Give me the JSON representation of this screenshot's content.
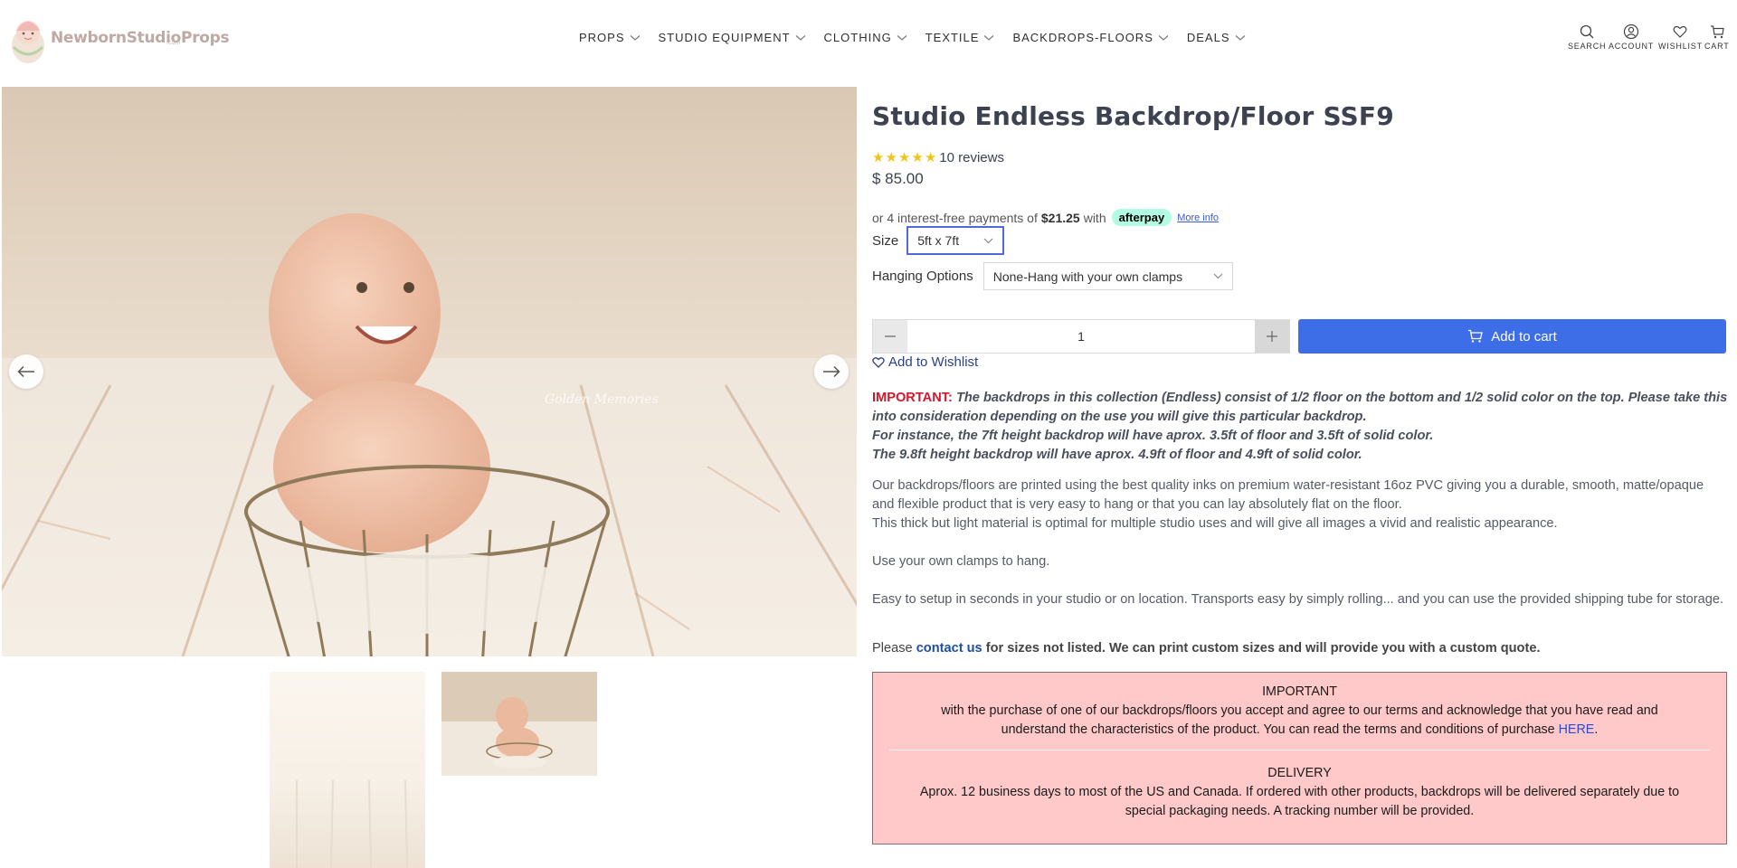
{
  "header": {
    "logo_text": "NewbornStudioProps",
    "logo_sub": ".com",
    "nav": [
      {
        "label": "PROPS"
      },
      {
        "label": "STUDIO EQUIPMENT"
      },
      {
        "label": "CLOTHING"
      },
      {
        "label": "TEXTILE"
      },
      {
        "label": "BACKDROPS-FLOORS"
      },
      {
        "label": "DEALS"
      }
    ],
    "utilities": {
      "search": "SEARCH",
      "account": "ACCOUNT",
      "wishlist": "WISHLIST",
      "cart": "CART"
    }
  },
  "gallery": {
    "watermark": "Golden Memories",
    "thumbnail_count": 2
  },
  "product": {
    "title": "Studio Endless Backdrop/Floor SSF9",
    "rating_stars": 5,
    "reviews": "10 reviews",
    "price": "$ 85.00",
    "afterpay": {
      "prefix": "or 4 interest-free payments of",
      "amount": "$21.25",
      "suffix": "with",
      "badge": "afterpay",
      "more_info": "More info"
    },
    "size": {
      "label": "Size",
      "selected": "5ft x 7ft"
    },
    "hanging": {
      "label": "Hanging Options",
      "selected": "None-Hang with your own clamps"
    },
    "quantity": "1",
    "add_to_cart": "Add to cart",
    "add_to_wishlist": "Add to Wishlist",
    "important": {
      "label": "IMPORTANT:",
      "line1": "The backdrops in this collection (Endless) consist of 1/2 floor on the bottom and 1/2 solid color on the top. Please take this into consideration depending on the use you will give this particular backdrop.",
      "line2": "For instance, the 7ft height backdrop will have aprox. 3.5ft of floor and 3.5ft of solid color.",
      "line3": "The 9.8ft height backdrop will have aprox. 4.9ft of floor and 4.9ft of solid color."
    },
    "description": {
      "p1a": "Our backdrops/floors are printed using the best quality inks on premium water-resistant 16oz PVC giving you a durable, smooth, matte/opaque and flexible product that is very easy to hang or that you can lay absolutely flat on the floor.",
      "p1b": "This thick but light material is optimal for multiple studio uses and will give all images a vivid and realistic appearance.",
      "p2": "Use your own clamps to hang.",
      "p3": "Easy to setup in seconds in your studio or on location. Transports easy by simply rolling... and you can use the provided shipping tube for storage."
    },
    "contact": {
      "prefix": "Please",
      "link": "contact us",
      "suffix": "for sizes not listed. We can print custom sizes and will provide you with a custom quote."
    },
    "notice": {
      "important_heading": "IMPORTANT",
      "important_body": "with the purchase of one of our backdrops/floors you accept and agree to our terms and acknowledge that you have read and understand the characteristics of the product. You can read the terms and conditions of purchase",
      "here_link": "HERE",
      "delivery_heading": "DELIVERY",
      "delivery_body": "Aprox. 12 business days to most of the US and Canada. If ordered with other products, backdrops will be delivered separately due to special packaging needs. A tracking number will be provided."
    }
  },
  "colors": {
    "accent": "#3d6ee8",
    "important_red": "#d4162a",
    "notice_bg": "#ffc9c9",
    "star": "#f0c419",
    "afterpay_badge": "#b2fce4"
  }
}
